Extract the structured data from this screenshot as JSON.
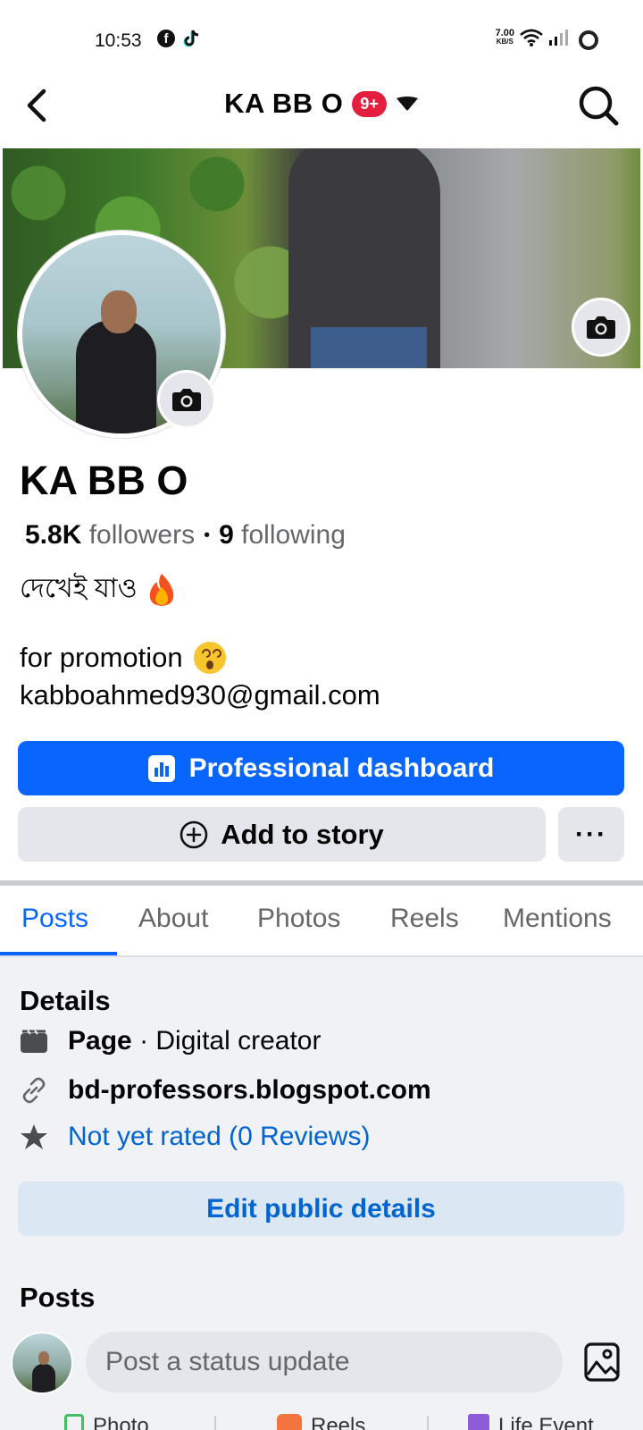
{
  "status_bar": {
    "time": "10:53",
    "net_speed_value": "7.00",
    "net_speed_unit": "KB/S"
  },
  "nav": {
    "title": "KA BB O",
    "badge": "9+"
  },
  "profile": {
    "name": "KA BB O",
    "followers_count": "5.8K",
    "followers_label": "followers",
    "separator": "•",
    "following_count": "9",
    "following_label": "following",
    "bio_line1": "দেখেই যাও",
    "bio_line2": "for promotion",
    "bio_email": "kabboahmed930@gmail.com"
  },
  "buttons": {
    "professional_dashboard": "Professional dashboard",
    "add_to_story": "Add to story",
    "more": "···"
  },
  "tabs": [
    {
      "label": "Posts",
      "active": true
    },
    {
      "label": "About",
      "active": false
    },
    {
      "label": "Photos",
      "active": false
    },
    {
      "label": "Reels",
      "active": false
    },
    {
      "label": "Mentions",
      "active": false
    }
  ],
  "details": {
    "title": "Details",
    "page_label": "Page",
    "page_category": "· Digital creator",
    "website": "bd-professors.blogspot.com",
    "rating": "Not yet rated (0 Reviews)",
    "edit_button": "Edit public details"
  },
  "posts": {
    "title": "Posts",
    "composer_placeholder": "Post a status update"
  },
  "bottom_actions": [
    "Photo",
    "Reels",
    "Life Event"
  ],
  "colors": {
    "brand_blue": "#0866ff",
    "link_blue": "#0064d1",
    "badge_red": "#e41e3f",
    "button_gray": "#e4e6eb"
  },
  "icons": {
    "back": "back-arrow-icon",
    "search": "search-icon",
    "camera": "camera-icon",
    "dashboard": "bar-chart-icon",
    "add_story": "plus-circle-icon",
    "page": "clapper-icon",
    "link": "link-icon",
    "star": "star-icon",
    "photo": "image-icon"
  }
}
